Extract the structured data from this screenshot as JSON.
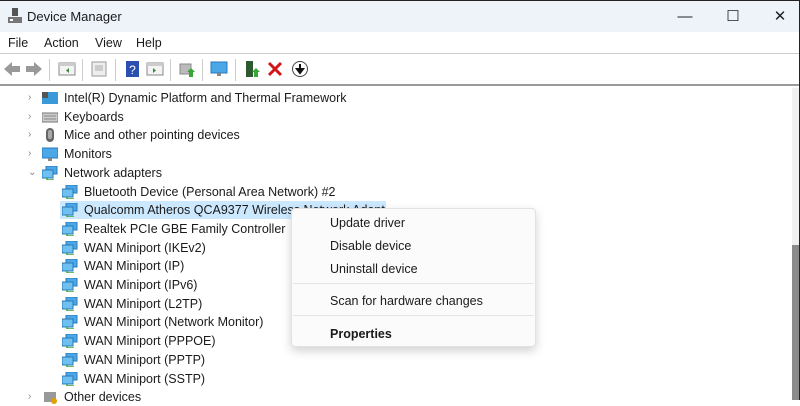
{
  "window": {
    "title": "Device Manager",
    "minimize": "—",
    "maximize": "☐",
    "close": "✕"
  },
  "menu": [
    "File",
    "Action",
    "View",
    "Help"
  ],
  "toolbar": [
    "back-icon",
    "forward-icon",
    "show-hide-console-tree-icon",
    "properties-icon",
    "help-icon",
    "action-pane-icon",
    "update-driver-icon",
    "scan-hardware-icon",
    "enable-device-icon",
    "uninstall-icon",
    "disable-device-icon"
  ],
  "tree": {
    "categories_before": [
      {
        "label": "Intel(R) Dynamic Platform and Thermal Framework",
        "icon": "intel-icon"
      },
      {
        "label": "Keyboards",
        "icon": "keyboard-icon"
      },
      {
        "label": "Mice and other pointing devices",
        "icon": "mouse-icon"
      },
      {
        "label": "Monitors",
        "icon": "monitor-icon"
      }
    ],
    "expanded": {
      "label": "Network adapters",
      "icon": "network-icon"
    },
    "children": [
      "Bluetooth Device (Personal Area Network) #2",
      "Qualcomm Atheros QCA9377 Wireless Network Adapter",
      "Realtek PCIe GBE Family Controller",
      "WAN Miniport (IKEv2)",
      "WAN Miniport (IP)",
      "WAN Miniport (IPv6)",
      "WAN Miniport (L2TP)",
      "WAN Miniport (Network Monitor)",
      "WAN Miniport (PPPOE)",
      "WAN Miniport (PPTP)",
      "WAN Miniport (SSTP)"
    ],
    "selected_index": 1,
    "categories_after": [
      {
        "label": "Other devices",
        "icon": "other-devices-icon"
      }
    ]
  },
  "context_menu": {
    "update": "Update driver",
    "disable": "Disable device",
    "uninstall": "Uninstall device",
    "scan": "Scan for hardware changes",
    "properties": "Properties"
  },
  "colors": {
    "selection": "#cce8ff",
    "titlebar": "#eef3fa"
  }
}
